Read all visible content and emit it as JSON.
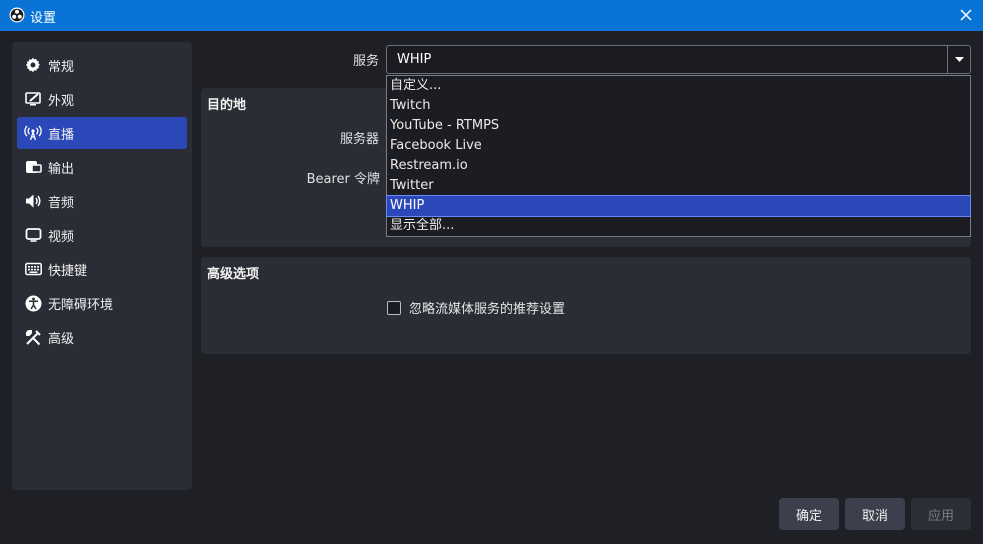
{
  "window": {
    "title": "设置",
    "app_icon": "obs-logo-icon",
    "close_icon": "close-icon"
  },
  "sidebar": {
    "items": [
      {
        "label": "常规",
        "icon": "gear-icon"
      },
      {
        "label": "外观",
        "icon": "appearance-icon"
      },
      {
        "label": "直播",
        "icon": "broadcast-icon",
        "active": true
      },
      {
        "label": "输出",
        "icon": "output-icon"
      },
      {
        "label": "音频",
        "icon": "speaker-icon"
      },
      {
        "label": "视频",
        "icon": "monitor-icon"
      },
      {
        "label": "快捷键",
        "icon": "keyboard-icon"
      },
      {
        "label": "无障碍环境",
        "icon": "accessibility-icon"
      },
      {
        "label": "高级",
        "icon": "tools-icon"
      }
    ]
  },
  "stream": {
    "service_label": "服务",
    "service_value": "WHIP",
    "destination_title": "目的地",
    "server_label": "服务器",
    "bearer_label": "Bearer 令牌",
    "advanced_title": "高级选项",
    "ignore_recommendations_label": "忽略流媒体服务的推荐设置",
    "ignore_recommendations_checked": false
  },
  "service_dropdown": {
    "options": [
      "自定义...",
      "Twitch",
      "YouTube - RTMPS",
      "Facebook Live",
      "Restream.io",
      "Twitter",
      "WHIP",
      "显示全部..."
    ],
    "selected": "WHIP"
  },
  "buttons": {
    "ok": "确定",
    "cancel": "取消",
    "apply": "应用"
  },
  "colors": {
    "titlebar": "#0a74d6",
    "accent": "#2a48b8",
    "background": "#1f2026",
    "panel": "#2b2d36"
  }
}
